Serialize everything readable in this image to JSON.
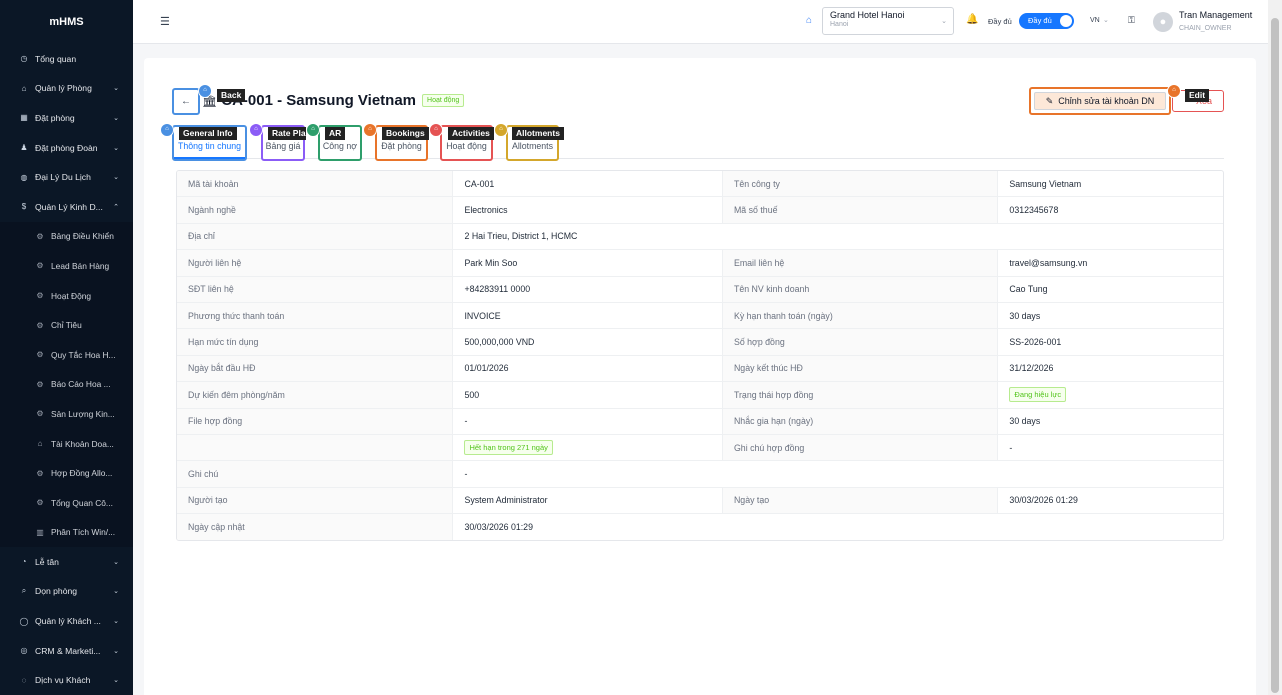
{
  "sidebar": {
    "logo": "mHMS",
    "items": [
      {
        "label": "Tổng quan",
        "icon": "dashboard-icon",
        "glyph": "◷"
      },
      {
        "label": "Quản lý Phòng",
        "icon": "home-icon",
        "glyph": "⌂",
        "chevron": "⌄"
      },
      {
        "label": "Đặt phòng",
        "icon": "calendar-icon",
        "glyph": "▦",
        "chevron": "⌄"
      },
      {
        "label": "Đặt phòng Đoàn",
        "icon": "group-icon",
        "glyph": "♟",
        "chevron": "⌄"
      },
      {
        "label": "Đại Lý Du Lịch",
        "icon": "globe-icon",
        "glyph": "◍",
        "chevron": "⌄"
      },
      {
        "label": "Quản Lý Kinh D...",
        "icon": "dollar-icon",
        "glyph": "$",
        "chevron": "⌃"
      }
    ],
    "subitems": [
      {
        "label": "Bảng Điều Khiển",
        "glyph": "⚙"
      },
      {
        "label": "Lead Bán Hàng",
        "glyph": "⚙"
      },
      {
        "label": "Hoạt Động",
        "glyph": "⚙"
      },
      {
        "label": "Chỉ Tiêu",
        "glyph": "⚙"
      },
      {
        "label": "Quy Tắc Hoa H...",
        "glyph": "⚙"
      },
      {
        "label": "Báo Cáo Hoa ...",
        "glyph": "⚙"
      },
      {
        "label": "Sản Lượng Kin...",
        "glyph": "⚙"
      },
      {
        "label": "Tài Khoản Doa...",
        "glyph": "⌂"
      },
      {
        "label": "Hợp Đồng Allo...",
        "glyph": "⚙"
      },
      {
        "label": "Tổng Quan Cô...",
        "glyph": "⚙"
      },
      {
        "label": "Phân Tích Win/...",
        "glyph": "▥"
      }
    ],
    "bottom_items": [
      {
        "label": "Lễ tân",
        "icon": "bell-icon",
        "glyph": "◔",
        "chevron": "⌄"
      },
      {
        "label": "Dọn phòng",
        "icon": "broom-icon",
        "glyph": "⌕",
        "chevron": "⌄"
      },
      {
        "label": "Quản lý Khách ...",
        "icon": "user-icon",
        "glyph": "◯",
        "chevron": "⌄"
      },
      {
        "label": "CRM & Marketi...",
        "icon": "crm-icon",
        "glyph": "◎",
        "chevron": "⌄"
      },
      {
        "label": "Dịch vụ Khách",
        "icon": "service-icon",
        "glyph": "◌",
        "chevron": "⌄"
      }
    ]
  },
  "header": {
    "menu_glyph": "☰",
    "home_glyph": "⌂",
    "hotel_name": "Grand Hotel Hanoi",
    "hotel_city": "Hanoi",
    "select_chev": "⌄",
    "bell_glyph": "🔔",
    "full_label": "Đầy đủ",
    "toggle_label": "Đầy đủ",
    "lang": "VN",
    "lang_chev": "⌄",
    "key_glyph": "⚿",
    "avatar_glyph": "●",
    "user_name": "Tran Management",
    "user_role": "CHAIN_OWNER"
  },
  "page": {
    "back_glyph": "←",
    "title_glyph": "🏛",
    "title": "CA-001 - Samsung Vietnam",
    "status": "Hoạt động",
    "edit_glyph": "✎",
    "edit_label": "Chỉnh sửa tài khoản DN",
    "other_label": "Xóa",
    "tabs": [
      {
        "label": "Thông tin chung"
      },
      {
        "label": "Bảng giá"
      },
      {
        "label": "Công nợ"
      },
      {
        "label": "Đặt phòng"
      },
      {
        "label": "Hoạt động"
      },
      {
        "label": "Allotments"
      }
    ]
  },
  "markers": [
    {
      "label": "Back",
      "color": "#4a90e2"
    },
    {
      "label": "General Info",
      "color": "#4a90e2"
    },
    {
      "label": "Rate Plan",
      "color": "#8b5cf6"
    },
    {
      "label": "AR",
      "color": "#2e9e6b"
    },
    {
      "label": "Bookings",
      "color": "#e8742a"
    },
    {
      "label": "Activities",
      "color": "#e55353"
    },
    {
      "label": "Allotments",
      "color": "#d4a72c"
    },
    {
      "label": "Edit",
      "color": "#e8742a"
    }
  ],
  "details": {
    "r1": {
      "l1": "Mã tài khoản",
      "v1": "CA-001",
      "l2": "Tên công ty",
      "v2": "Samsung Vietnam"
    },
    "r2": {
      "l1": "Ngành nghề",
      "v1": "Electronics",
      "l2": "Mã số thuế",
      "v2": "0312345678"
    },
    "r3": {
      "l1": "Địa chỉ",
      "v1": "2 Hai Trieu, District 1, HCMC"
    },
    "r4": {
      "l1": "Người liên hệ",
      "v1": "Park Min Soo",
      "l2": "Email liên hệ",
      "v2": "travel@samsung.vn"
    },
    "r5": {
      "l1": "SĐT liên hệ",
      "v1": "+84283911 0000",
      "l2": "Tên NV kinh doanh",
      "v2": "Cao Tung"
    },
    "r6": {
      "l1": "Phương thức thanh toán",
      "v1": "INVOICE",
      "l2": "Kỳ hạn thanh toán (ngày)",
      "v2": "30 days"
    },
    "r7": {
      "l1": "Hạn mức tín dụng",
      "v1": "500,000,000 VND",
      "l2": "Số hợp đồng",
      "v2": "SS-2026-001"
    },
    "r8": {
      "l1": "Ngày bắt đầu HĐ",
      "v1": "01/01/2026",
      "l2": "Ngày kết thúc HĐ",
      "v2": "31/12/2026"
    },
    "r9": {
      "l1": "Dự kiến đêm phòng/năm",
      "v1": "500",
      "l2": "Trạng thái hợp đồng",
      "v2": "Đang hiệu lực"
    },
    "r10": {
      "l1": "File hợp đồng",
      "v1": "-",
      "l2": "Nhắc gia hạn (ngày)",
      "v2": "30 days"
    },
    "r11": {
      "l1": "",
      "v1": "Hết hạn trong 271 ngày",
      "l2": "Ghi chú hợp đồng",
      "v2": "-"
    },
    "r12": {
      "l1": "Ghi chú",
      "v1": "-"
    },
    "r13": {
      "l1": "Người tạo",
      "v1": "System Administrator",
      "l2": "Ngày tạo",
      "v2": "30/03/2026 01:29"
    },
    "r14": {
      "l1": "Ngày cập nhật",
      "v1": "30/03/2026 01:29"
    }
  }
}
